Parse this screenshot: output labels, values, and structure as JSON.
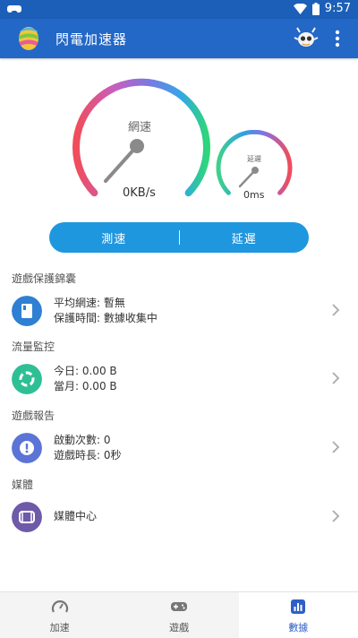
{
  "status_bar": {
    "time": "9:57"
  },
  "app_bar": {
    "title": "閃電加速器"
  },
  "gauges": {
    "speed": {
      "label": "網速",
      "value": "0KB/s"
    },
    "latency": {
      "label": "延遲",
      "value": "0ms"
    }
  },
  "test_buttons": {
    "speed_test": "測速",
    "latency_test": "延遲"
  },
  "sections": {
    "protection": {
      "title": "遊戲保護錦囊",
      "line1": "平均網速: 暫無",
      "line2": "保護時間: 數據收集中"
    },
    "traffic": {
      "title": "流量監控",
      "line1": "今日: 0.00 B",
      "line2": "當月: 0.00 B"
    },
    "report": {
      "title": "遊戲報告",
      "line1": "啟動次數: 0",
      "line2": "遊戲時長: 0秒"
    },
    "media": {
      "title": "媒體",
      "line1": "媒體中心"
    }
  },
  "bottom_nav": {
    "tabs": [
      {
        "label": "加速",
        "icon": "speedometer-icon"
      },
      {
        "label": "遊戲",
        "icon": "gamepad-icon"
      },
      {
        "label": "數據",
        "icon": "chart-icon"
      }
    ],
    "active": "數據"
  },
  "colors": {
    "app_bar": "#2367c7",
    "status_bar": "#1c5fb8",
    "test_button": "#1f97df",
    "icon_blue": "#2f7fd3",
    "icon_green": "#2fbf95",
    "icon_indigo": "#5b74d6",
    "icon_purple": "#6e5aa8",
    "active_tab": "#2f5fc8"
  }
}
